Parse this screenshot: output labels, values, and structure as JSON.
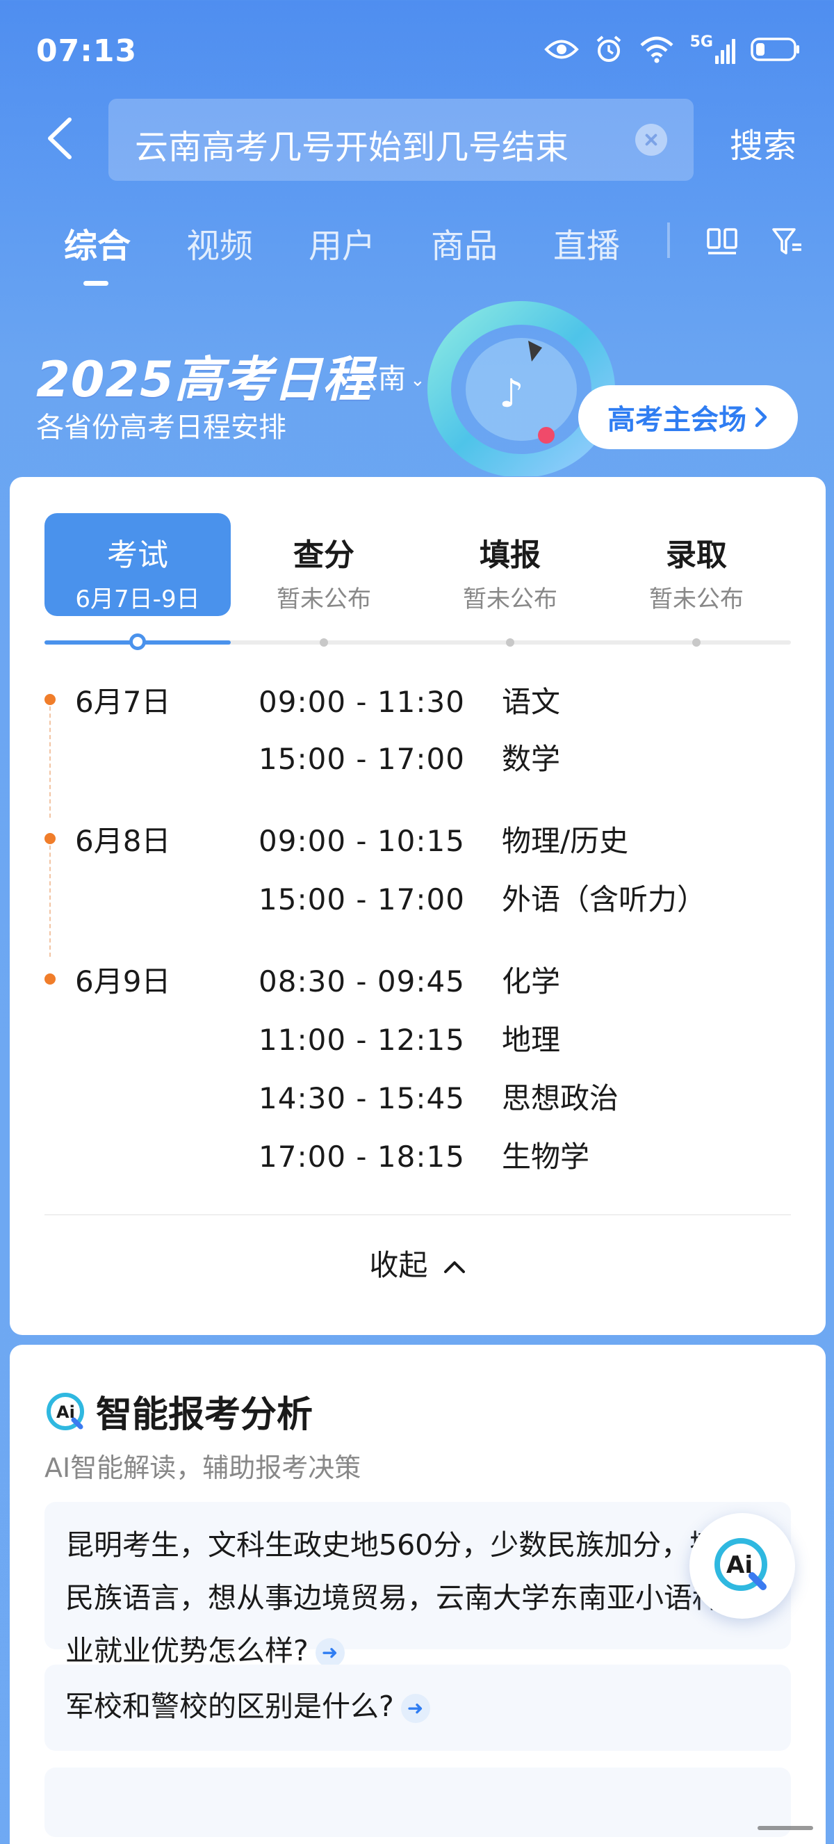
{
  "status_bar": {
    "time": "07:13",
    "network": "5G"
  },
  "search": {
    "query": "云南高考几号开始到几号结束",
    "button_label": "搜索"
  },
  "tabs": [
    {
      "label": "综合"
    },
    {
      "label": "视频"
    },
    {
      "label": "用户"
    },
    {
      "label": "商品"
    },
    {
      "label": "直播"
    }
  ],
  "banner": {
    "title": "2025高考日程",
    "region": "云南",
    "subtitle": "各省份高考日程安排",
    "main_venue_label": "高考主会场"
  },
  "stages": [
    {
      "name": "考试",
      "date": "6月7日-9日"
    },
    {
      "name": "查分",
      "date": "暂未公布"
    },
    {
      "name": "填报",
      "date": "暂未公布"
    },
    {
      "name": "录取",
      "date": "暂未公布"
    }
  ],
  "schedule": [
    {
      "date": "6月7日",
      "slots": [
        {
          "time": "09:00 - 11:30",
          "subject": "语文"
        },
        {
          "time": "15:00 - 17:00",
          "subject": "数学"
        }
      ]
    },
    {
      "date": "6月8日",
      "slots": [
        {
          "time": "09:00 - 10:15",
          "subject": "物理/历史"
        },
        {
          "time": "15:00 - 17:00",
          "subject": "外语（含听力）"
        }
      ]
    },
    {
      "date": "6月9日",
      "slots": [
        {
          "time": "08:30 - 09:45",
          "subject": "化学"
        },
        {
          "time": "11:00 - 12:15",
          "subject": "地理"
        },
        {
          "time": "14:30 - 15:45",
          "subject": "思想政治"
        },
        {
          "time": "17:00 - 18:15",
          "subject": "生物学"
        }
      ]
    }
  ],
  "collapse_label": "收起",
  "ai_section": {
    "title": "智能报考分析",
    "subtitle": "AI智能解读，辅助报考决策",
    "questions": [
      "昆明考生，文科生政史地560分，少数民族加分，擅长民族语言，想从事边境贸易，云南大学东南亚小语种专业就业优势怎么样?",
      "军校和警校的区别是什么?"
    ]
  },
  "colors": {
    "accent": "#4a92ec",
    "timeline_dot": "#f07d2a",
    "link": "#2f7df2"
  }
}
